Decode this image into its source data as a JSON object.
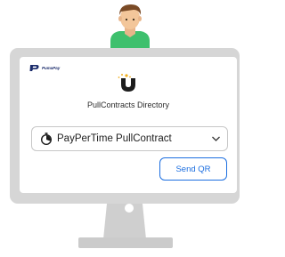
{
  "brand": {
    "name": "PumaPay",
    "color": "#1a2b6b"
  },
  "page": {
    "title": "PullContracts Directory"
  },
  "contract_select": {
    "selected": "PayPerTime PullContract",
    "icon": "stopwatch-icon"
  },
  "actions": {
    "send_qr_label": "Send QR",
    "accent": "#1d6fe0"
  },
  "illustration": {
    "figure": "person-avatar",
    "device": "desktop-monitor",
    "monitor_color": "#d6d6d6"
  }
}
